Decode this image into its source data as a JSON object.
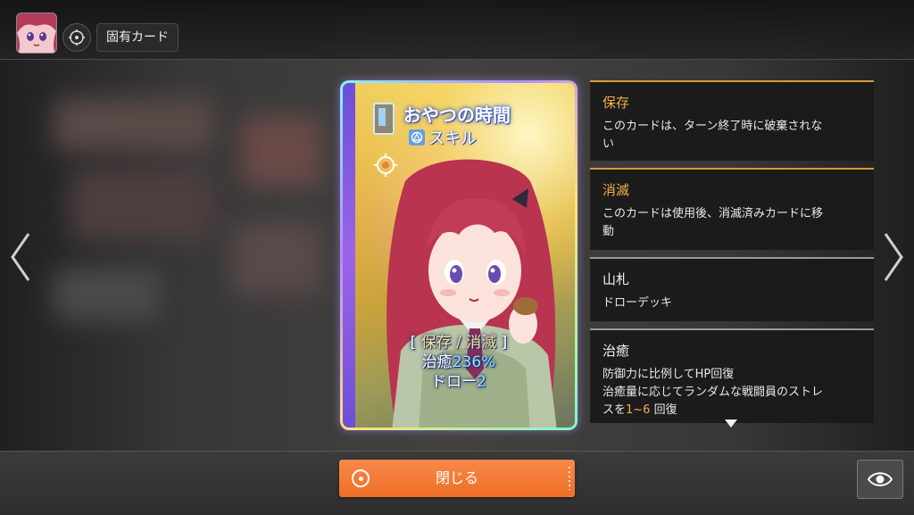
{
  "header": {
    "avatar_icon": "character-portrait-icon",
    "target_icon": "target-icon",
    "title": "固有カード"
  },
  "navigation": {
    "prev_icon": "chevron-left-icon",
    "next_icon": "chevron-right-icon"
  },
  "card": {
    "name": "おやつの時間",
    "type": "スキル",
    "keywords_open": "[ ",
    "keywords": "保存 / 消滅",
    "keywords_close": " ]",
    "heal_label": "治癒",
    "heal_value": "236%",
    "draw_label": "ドロー",
    "draw_value": "2",
    "frame_colors": [
      "#8cf3ff",
      "#b08cff",
      "#ffe07a",
      "#7affc8"
    ]
  },
  "keyword_panels": [
    {
      "title": "保存",
      "desc_lines": [
        "このカードは、ターン終了時に破棄されな",
        "い"
      ]
    },
    {
      "title": "消滅",
      "desc_lines": [
        "このカードは使用後、消滅済みカードに移",
        "動"
      ]
    },
    {
      "title": "山札",
      "desc_lines": [
        "ドローデッキ"
      ]
    },
    {
      "title": "治癒",
      "desc_lines": [
        "防御力に比例してHP回復",
        "治癒量に応じてランダムな戦闘員のストレ"
      ],
      "desc_last_prefix": "スを",
      "desc_last_highlight": "1~6",
      "desc_last_suffix": " 回復"
    }
  ],
  "footer": {
    "close_label": "閉じる",
    "eye_icon": "eye-icon"
  },
  "colors": {
    "accent_orange": "#ef6e25",
    "keyword_gold": "#f0b04a"
  }
}
